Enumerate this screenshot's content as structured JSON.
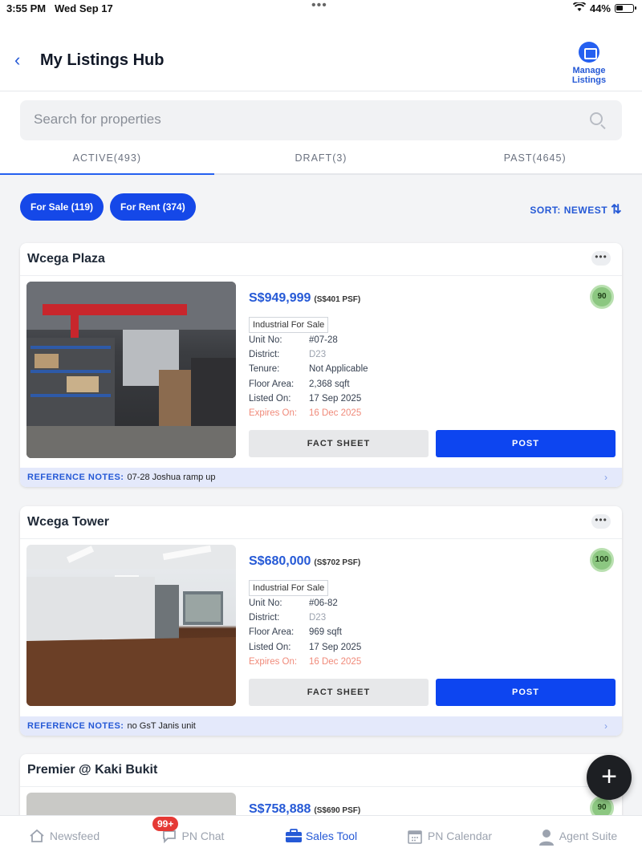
{
  "status_bar": {
    "time": "3:55 PM",
    "date": "Wed Sep 17",
    "battery": "44%",
    "battery_level": 0.44
  },
  "header": {
    "title": "My Listings Hub",
    "back_icon": "chevron-left-icon",
    "manage_label": "Manage Listings"
  },
  "search": {
    "placeholder": "Search for properties"
  },
  "tabs": [
    {
      "label": "ACTIVE(493)",
      "active": true
    },
    {
      "label": "DRAFT(3)",
      "active": false
    },
    {
      "label": "PAST(4645)",
      "active": false
    }
  ],
  "filters": {
    "sale": "For Sale (119)",
    "rent": "For Rent (374)"
  },
  "sort": {
    "label": "SORT: NEWEST"
  },
  "listings": [
    {
      "title": "Wcega Plaza",
      "price": "S$949,999",
      "psf": "(S$401 PSF)",
      "score": "90",
      "tag": "Industrial For Sale",
      "specs": [
        {
          "k": "Unit No:",
          "v": "#07-28"
        },
        {
          "k": "District:",
          "v": "D23"
        },
        {
          "k": "Tenure:",
          "v": "Not Applicable"
        },
        {
          "k": "Floor Area:",
          "v": "2,368 sqft"
        },
        {
          "k": "Listed On:",
          "v": "17 Sep 2025"
        },
        {
          "k": "Expires On:",
          "v": "16 Dec 2025"
        }
      ],
      "fact_sheet": "FACT SHEET",
      "post": "POST",
      "ref_label": "REFERENCE NOTES:",
      "ref_text": "07-28 Joshua ramp up"
    },
    {
      "title": "Wcega Tower",
      "price": "S$680,000",
      "psf": "(S$702 PSF)",
      "score": "100",
      "tag": "Industrial For Sale",
      "specs": [
        {
          "k": "Unit No:",
          "v": "#06-82"
        },
        {
          "k": "District:",
          "v": "D23"
        },
        {
          "k": "Floor Area:",
          "v": "969 sqft"
        },
        {
          "k": "Listed On:",
          "v": "17 Sep 2025"
        },
        {
          "k": "Expires On:",
          "v": "16 Dec 2025"
        }
      ],
      "fact_sheet": "FACT SHEET",
      "post": "POST",
      "ref_label": "REFERENCE NOTES:",
      "ref_text": "no GsT Janis unit"
    },
    {
      "title": "Premier @ Kaki Bukit",
      "price": "S$758,888",
      "psf": "(S$690 PSF)",
      "score": "90"
    }
  ],
  "tabbar": [
    {
      "label": "Newsfeed",
      "icon": "home-icon"
    },
    {
      "label": "PN Chat",
      "icon": "chat-icon",
      "badge": "99+"
    },
    {
      "label": "Sales Tool",
      "icon": "briefcase-icon",
      "active": true
    },
    {
      "label": "PN Calendar",
      "icon": "calendar-icon"
    },
    {
      "label": "Agent Suite",
      "icon": "person-icon"
    }
  ],
  "colors": {
    "accent": "#2559d6",
    "post_button": "#0d45f0",
    "chip": "#1548e8",
    "expiry": "#f08a7a",
    "score": "#8cc781"
  }
}
